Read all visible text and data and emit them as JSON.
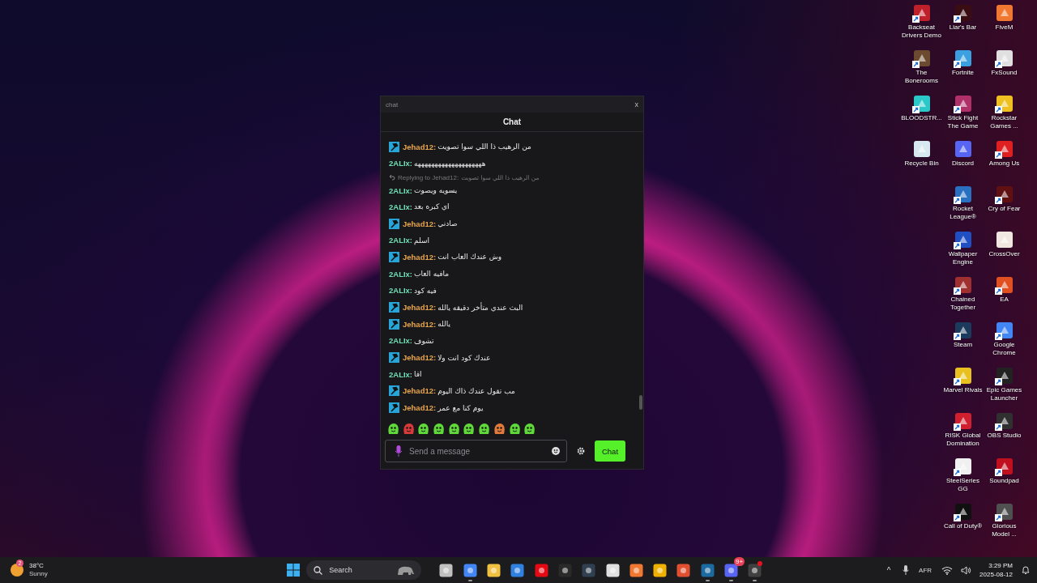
{
  "chat_window": {
    "title": "chat",
    "close": "x",
    "header": "Chat",
    "messages": [
      {
        "user": "Jehad12:",
        "color": "#e8a54c",
        "badge": true,
        "text": "من الرهيب ذا اللي سوا تصويت"
      },
      {
        "user": "2ALIx:",
        "color": "#6ee0b4",
        "badge": false,
        "text": "ههههههههههههههههههههه"
      },
      {
        "user": "2ALIx:",
        "color": "#6ee0b4",
        "badge": false,
        "reply": {
          "label": "Replying to Jehad12:",
          "text": "من الرهيب ذا اللي سوا تصويت"
        },
        "text": "يسويه ويصوت"
      },
      {
        "user": "2ALIx:",
        "color": "#6ee0b4",
        "badge": false,
        "text": "اي كبره بعد"
      },
      {
        "user": "Jehad12:",
        "color": "#e8a54c",
        "badge": true,
        "text": "صادني"
      },
      {
        "user": "2ALIx:",
        "color": "#6ee0b4",
        "badge": false,
        "text": "اسلم"
      },
      {
        "user": "Jehad12:",
        "color": "#e8a54c",
        "badge": true,
        "text": "وش عندك العاب انت"
      },
      {
        "user": "2ALIx:",
        "color": "#6ee0b4",
        "badge": false,
        "text": "مافيه العاب"
      },
      {
        "user": "2ALIx:",
        "color": "#6ee0b4",
        "badge": false,
        "text": "فيه كود"
      },
      {
        "user": "Jehad12:",
        "color": "#e8a54c",
        "badge": true,
        "text": "البث عندي متأخر دقيقه يالله"
      },
      {
        "user": "Jehad12:",
        "color": "#e8a54c",
        "badge": true,
        "text": "يالله"
      },
      {
        "user": "2ALIx:",
        "color": "#6ee0b4",
        "badge": false,
        "text": "تشوف"
      },
      {
        "user": "Jehad12:",
        "color": "#e8a54c",
        "badge": true,
        "text": "عندك كود انت ولا"
      },
      {
        "user": "2ALIx:",
        "color": "#6ee0b4",
        "badge": false,
        "text": "اقا"
      },
      {
        "user": "Jehad12:",
        "color": "#e8a54c",
        "badge": true,
        "text": "مب تقول عندك ذاك اليوم"
      },
      {
        "user": "Jehad12:",
        "color": "#e8a54c",
        "badge": true,
        "text": "يوم كنا مع عمر"
      }
    ],
    "emotes": [
      {
        "color": "#5fd83a"
      },
      {
        "color": "#d83a3a"
      },
      {
        "color": "#5fd83a"
      },
      {
        "color": "#5fd83a"
      },
      {
        "color": "#5fd83a"
      },
      {
        "color": "#5fd83a"
      },
      {
        "color": "#5fd83a"
      },
      {
        "color": "#e07a3a"
      },
      {
        "color": "#5fd83a"
      },
      {
        "color": "#5fd83a"
      }
    ],
    "input": {
      "placeholder": "Send a message"
    },
    "send_button": "Chat"
  },
  "desktop_icons": [
    [
      {
        "label": "Backseat Drivers Demo",
        "color": "#c0202a",
        "shortcut": true
      },
      {
        "label": "The Bonerooms",
        "color": "#6b4a2f",
        "shortcut": true
      },
      {
        "label": "BLOODSTR...",
        "color": "#2ac8c8",
        "shortcut": true
      },
      {
        "label": "Recycle Bin",
        "color": "#d8e8f0",
        "shortcut": false
      }
    ],
    [
      {
        "label": "Liar's Bar",
        "color": "#3a0d12",
        "shortcut": true
      },
      {
        "label": "Fortnite",
        "color": "#3aa0e0",
        "shortcut": true
      },
      {
        "label": "Stick Fight The Game",
        "color": "#b0306a",
        "shortcut": true
      },
      {
        "label": "Discord",
        "color": "#5865f2",
        "shortcut": false
      },
      {
        "label": "Rocket League®",
        "color": "#2a70c0",
        "shortcut": true
      },
      {
        "label": "Wallpaper Engine",
        "color": "#1f4fc0",
        "shortcut": true
      },
      {
        "label": "Chained Together",
        "color": "#a03030",
        "shortcut": true
      },
      {
        "label": "Steam",
        "color": "#1b3a5c",
        "shortcut": true
      },
      {
        "label": "Marvel Rivals",
        "color": "#e8c020",
        "shortcut": true
      },
      {
        "label": "RISK Global Domination",
        "color": "#d02030",
        "shortcut": true
      },
      {
        "label": "SteelSeries GG",
        "color": "#f0f0f0",
        "shortcut": true
      },
      {
        "label": "Call of Duty®",
        "color": "#101010",
        "shortcut": true
      }
    ],
    [
      {
        "label": "FiveM",
        "color": "#f07830",
        "shortcut": false
      },
      {
        "label": "FxSound",
        "color": "#e0e0e0",
        "shortcut": true
      },
      {
        "label": "Rockstar Games ...",
        "color": "#f0c020",
        "shortcut": true
      },
      {
        "label": "Among Us",
        "color": "#e02020",
        "shortcut": true
      },
      {
        "label": "Cry of Fear",
        "color": "#601010",
        "shortcut": true
      },
      {
        "label": "CrossOver",
        "color": "#f0e8e0",
        "shortcut": false
      },
      {
        "label": "EA",
        "color": "#e05020",
        "shortcut": true
      },
      {
        "label": "Google Chrome",
        "color": "#4285f4",
        "shortcut": true
      },
      {
        "label": "Epic Games Launcher",
        "color": "#222222",
        "shortcut": true
      },
      {
        "label": "OBS Studio",
        "color": "#303030",
        "shortcut": true
      },
      {
        "label": "Soundpad",
        "color": "#c01020",
        "shortcut": true
      },
      {
        "label": "Glorious Model ...",
        "color": "#505050",
        "shortcut": true
      }
    ]
  ],
  "taskbar": {
    "weather": {
      "temperature": "38°C",
      "condition": "Sunny",
      "badge": "2"
    },
    "search": {
      "placeholder": "Search"
    },
    "apps": [
      {
        "color": "#c0c0c0",
        "running": false
      },
      {
        "color": "#4285f4",
        "running": true
      },
      {
        "color": "#f0c040",
        "running": false
      },
      {
        "color": "#3080e0",
        "running": false
      },
      {
        "color": "#e50914",
        "running": false
      },
      {
        "color": "#2a2a2a",
        "running": false
      },
      {
        "color": "#304050",
        "running": false
      },
      {
        "color": "#e0e0e0",
        "running": false
      },
      {
        "color": "#f07830",
        "running": false
      },
      {
        "color": "#f0b000",
        "running": false
      },
      {
        "color": "#e05030",
        "running": false
      },
      {
        "color": "#1b6aa0",
        "running": true
      },
      {
        "color": "#5865f2",
        "running": true,
        "badge": "9+"
      },
      {
        "color": "#404040",
        "running": true,
        "alert": true
      }
    ],
    "tray": {
      "chevron": "^",
      "language": "AFR",
      "time": "3:29 PM",
      "date": "2025-08-12"
    }
  }
}
